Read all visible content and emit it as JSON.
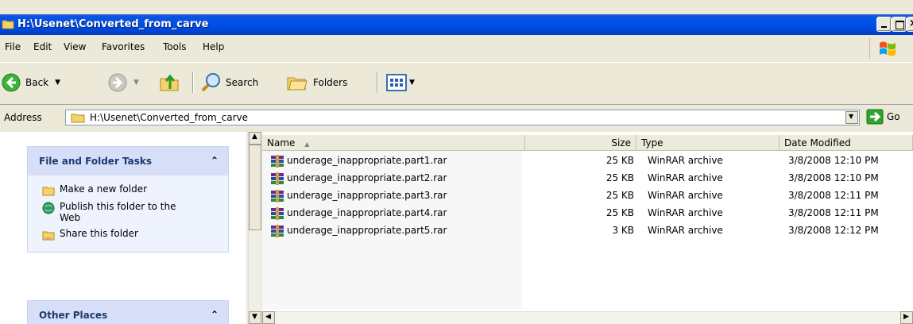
{
  "window": {
    "title": "H:\\Usenet\\Converted_from_carve"
  },
  "menu": {
    "items": [
      {
        "label": "File"
      },
      {
        "label": "Edit"
      },
      {
        "label": "View"
      },
      {
        "label": "Favorites"
      },
      {
        "label": "Tools"
      },
      {
        "label": "Help"
      }
    ]
  },
  "toolbar": {
    "back_label": "Back",
    "search_label": "Search",
    "folders_label": "Folders"
  },
  "address": {
    "label": "Address",
    "value": "H:\\Usenet\\Converted_from_carve",
    "go_label": "Go"
  },
  "sidebar": {
    "file_tasks": {
      "title": "File and Folder Tasks",
      "items": [
        {
          "label": "Make a new folder",
          "icon": "new-folder-icon"
        },
        {
          "label": "Publish this folder to the Web",
          "icon": "publish-web-icon"
        },
        {
          "label": "Share this folder",
          "icon": "share-folder-icon"
        }
      ]
    },
    "other_places": {
      "title": "Other Places"
    }
  },
  "filelist": {
    "columns": [
      "Name",
      "Size",
      "Type",
      "Date Modified"
    ],
    "rows": [
      {
        "name": "underage_inappropriate.part1.rar",
        "size": "25 KB",
        "type": "WinRAR archive",
        "date": "3/8/2008 12:10 PM"
      },
      {
        "name": "underage_inappropriate.part2.rar",
        "size": "25 KB",
        "type": "WinRAR archive",
        "date": "3/8/2008 12:10 PM"
      },
      {
        "name": "underage_inappropriate.part3.rar",
        "size": "25 KB",
        "type": "WinRAR archive",
        "date": "3/8/2008 12:11 PM"
      },
      {
        "name": "underage_inappropriate.part4.rar",
        "size": "25 KB",
        "type": "WinRAR archive",
        "date": "3/8/2008 12:11 PM"
      },
      {
        "name": "underage_inappropriate.part5.rar",
        "size": "3 KB",
        "type": "WinRAR archive",
        "date": "3/8/2008 12:12 PM"
      }
    ]
  },
  "colors": {
    "titlebar": "#0050e8",
    "chrome": "#ece9d8",
    "task_pane": "#d6dff7"
  }
}
